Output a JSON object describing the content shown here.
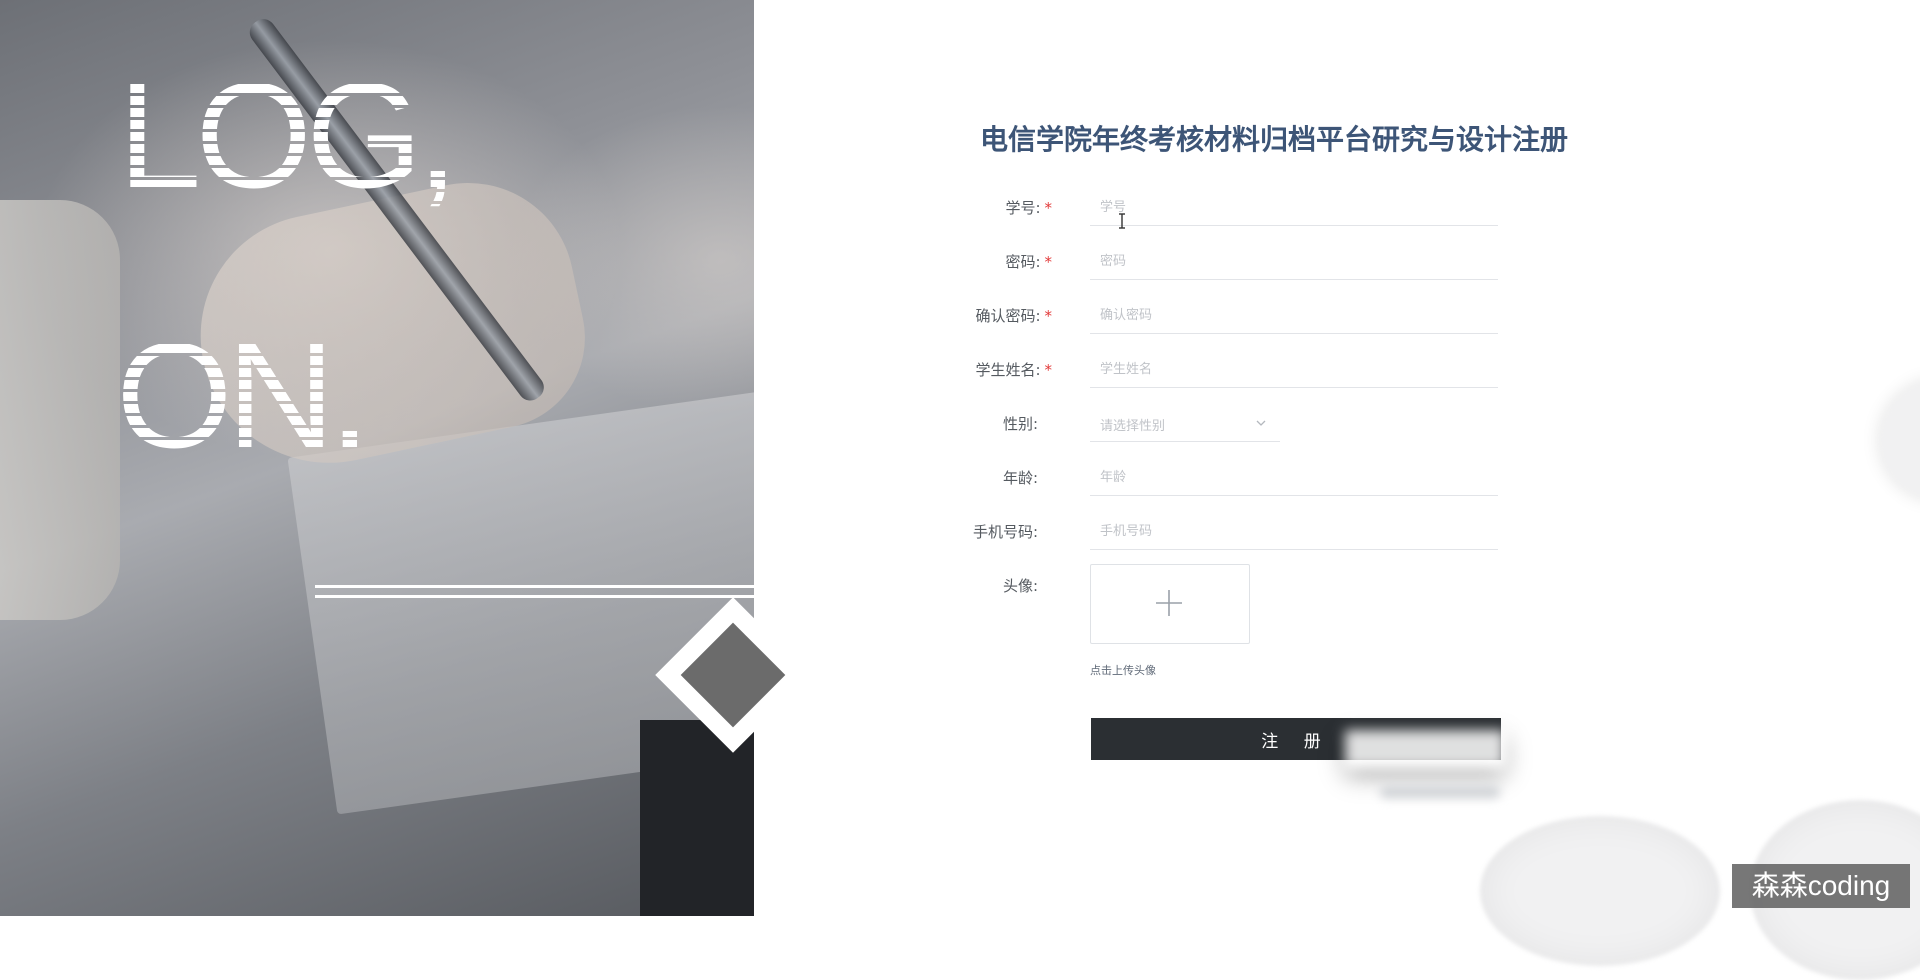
{
  "hero": {
    "line1": "LOG,",
    "line2": "ON."
  },
  "form": {
    "title": "电信学院年终考核材料归档平台研究与设计注册",
    "fields": [
      {
        "label": "学号:",
        "required": "*",
        "placeholder": "学号"
      },
      {
        "label": "密码:",
        "required": "*",
        "placeholder": "密码"
      },
      {
        "label": "确认密码:",
        "required": "*",
        "placeholder": "确认密码"
      },
      {
        "label": "学生姓名:",
        "required": "*",
        "placeholder": "学生姓名"
      },
      {
        "label": "性别:",
        "placeholder": "请选择性别",
        "icon": "chevron-down-icon"
      },
      {
        "label": "年龄:",
        "placeholder": "年龄"
      },
      {
        "label": "手机号码:",
        "placeholder": "手机号码"
      }
    ],
    "avatar": {
      "label": "头像:",
      "hint": "点击上传头像",
      "icon": "plus-icon"
    },
    "submit_label": "注 册"
  },
  "watermark": "森森coding",
  "colors": {
    "title": "#3d5577",
    "required": "#e23a3a",
    "button": "#2b2f33"
  }
}
